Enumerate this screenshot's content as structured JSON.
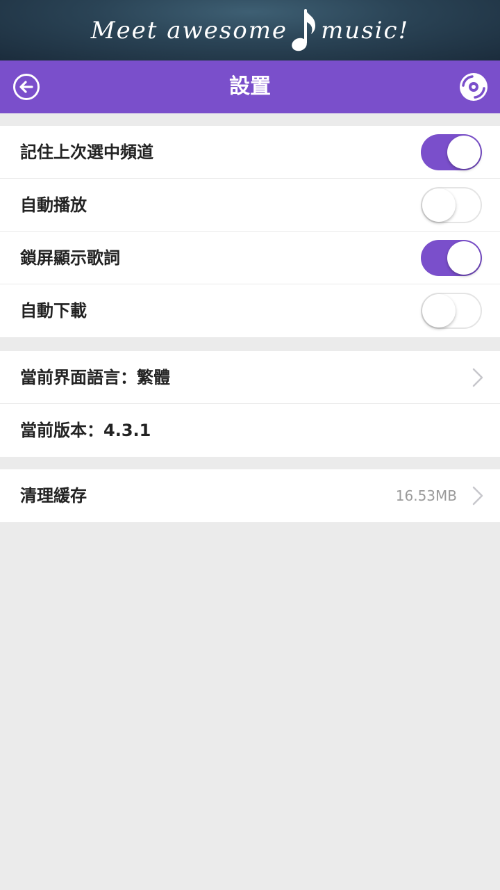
{
  "banner": {
    "text_left": "Meet awesome",
    "text_right": "music!"
  },
  "navbar": {
    "title": "設置",
    "back_icon": "back-arrow-circle-icon",
    "disc_icon": "disc-icon"
  },
  "settings": {
    "remember_channel": {
      "label": "記住上次選中頻道",
      "enabled": true
    },
    "auto_play": {
      "label": "自動播放",
      "enabled": false
    },
    "lock_screen_lyrics": {
      "label": "鎖屏顯示歌詞",
      "enabled": true
    },
    "auto_download": {
      "label": "自動下載",
      "enabled": false
    }
  },
  "info": {
    "language_label": "當前界面語言：",
    "language_value": "繁體",
    "version_label": "當前版本：",
    "version_value": "4.3.1"
  },
  "cache": {
    "label": "清理緩存",
    "size": "16.53MB"
  },
  "colors": {
    "accent": "#7a4fcb",
    "background": "#ebebeb",
    "banner": "#2a4355"
  }
}
